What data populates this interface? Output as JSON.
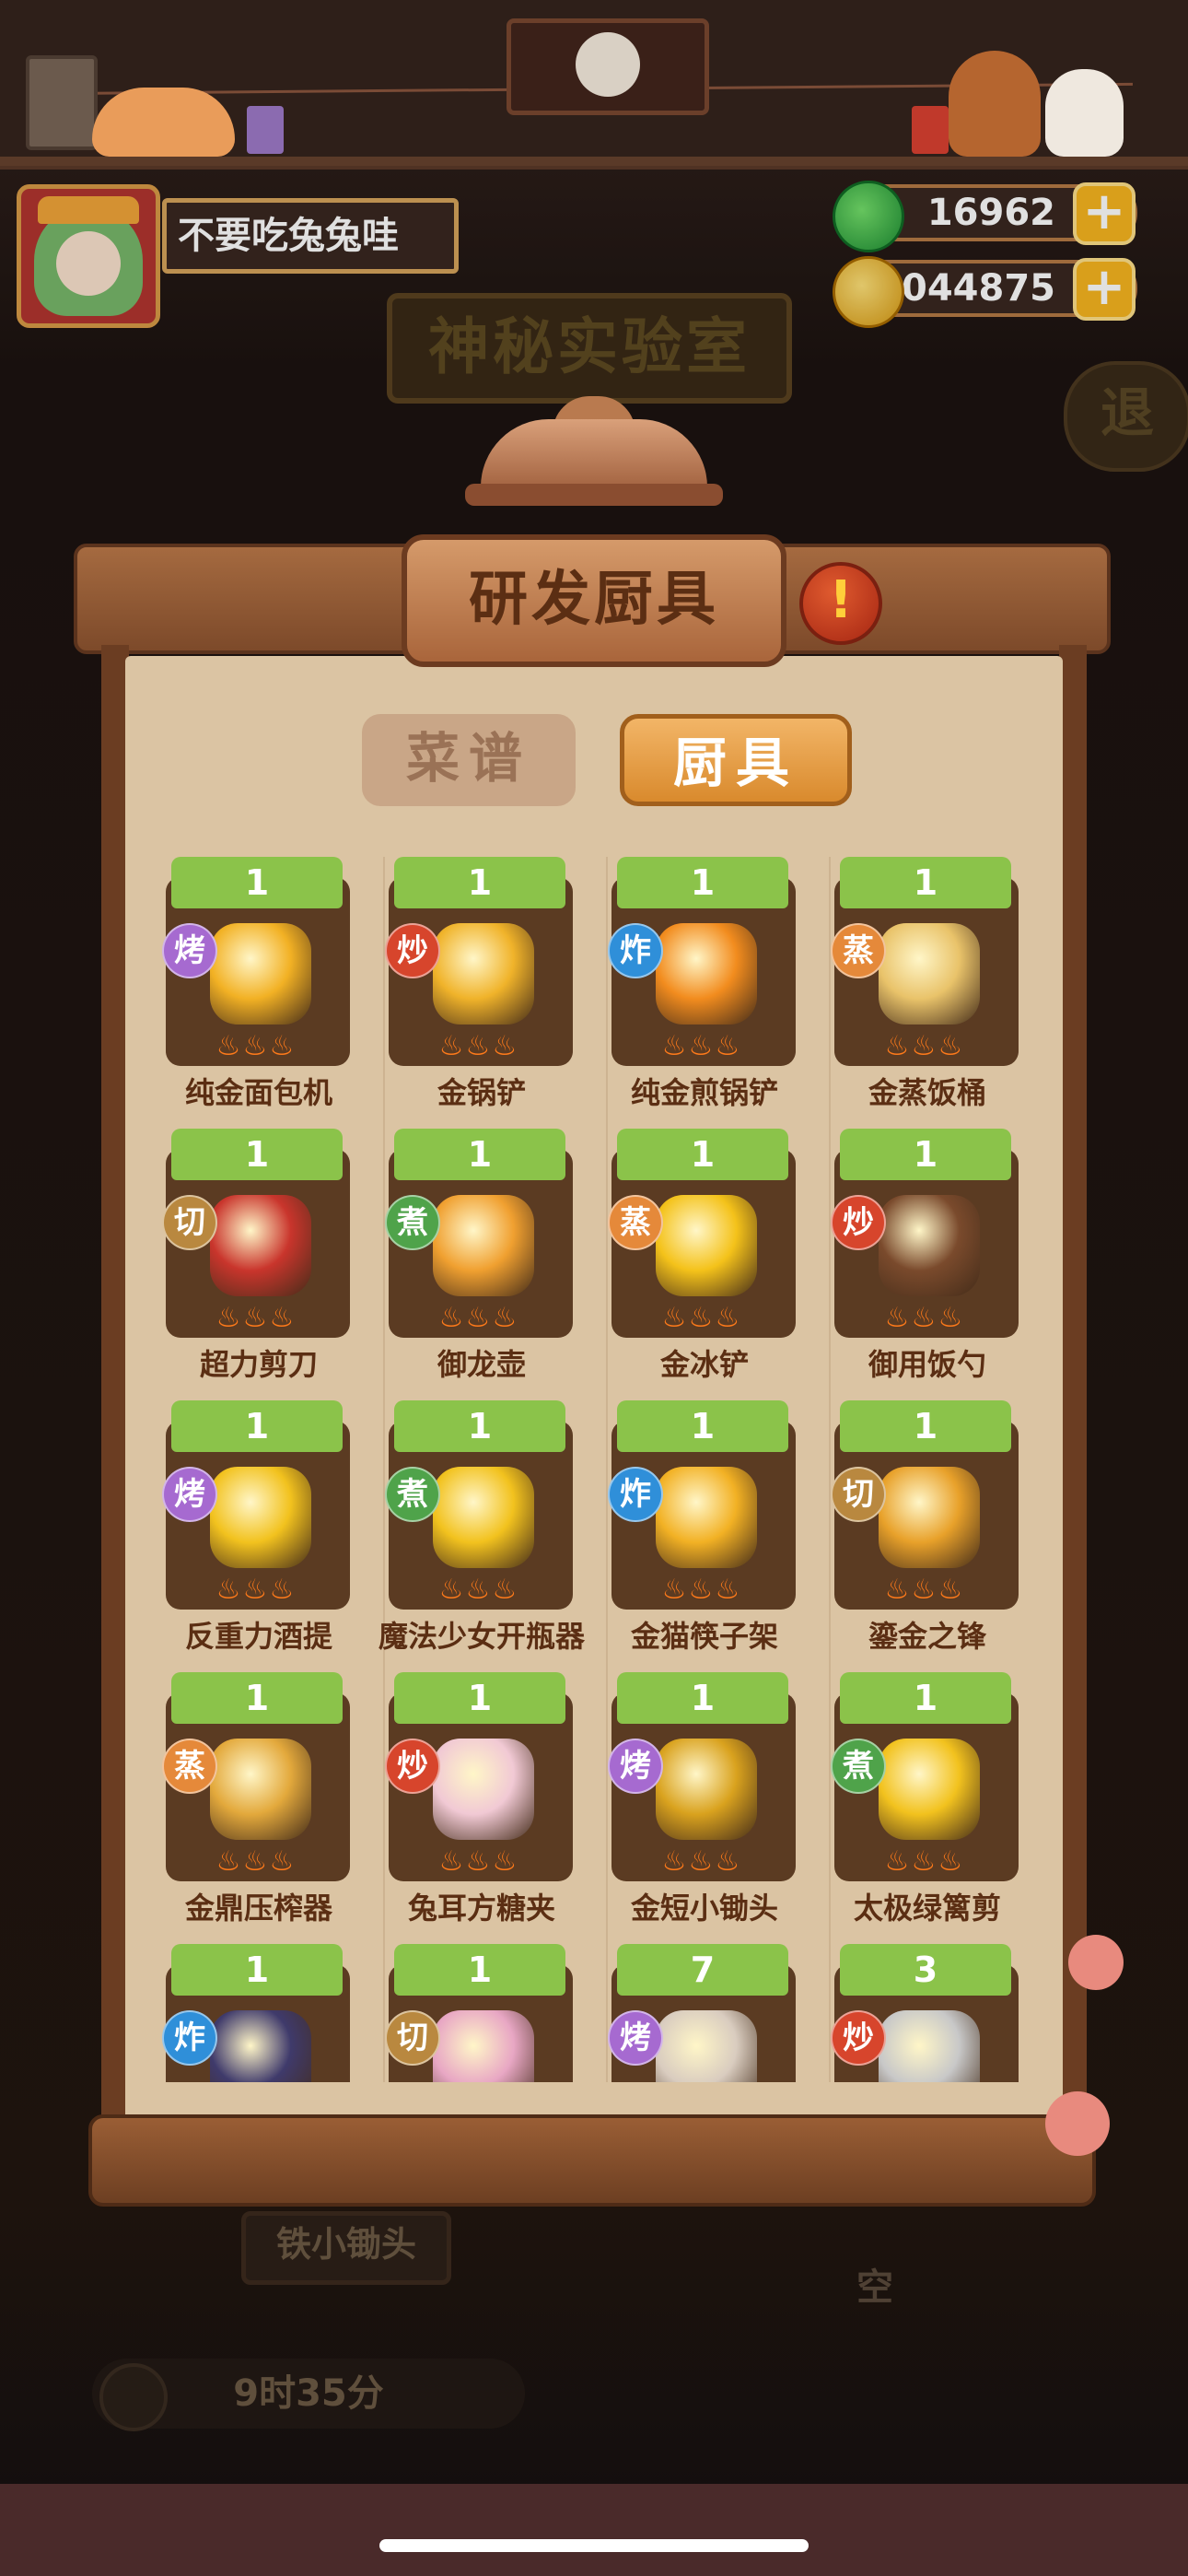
{
  "player": {
    "name": "不要吃兔兔哇"
  },
  "currency": {
    "jade": "16962",
    "coins": "80044875",
    "plus": "+"
  },
  "background": {
    "lab_title": "神秘实验室",
    "exit_label": "退",
    "station_label": "铁小锄头",
    "slot_status": "空",
    "timer": "9时35分"
  },
  "panel": {
    "title": "研发厨具",
    "alert_symbol": "!",
    "tabs": [
      {
        "label": "菜谱",
        "active": false
      },
      {
        "label": "厨具",
        "active": true
      }
    ]
  },
  "method_colors": {
    "烤": "#a66ad0",
    "炒": "#d7452c",
    "炸": "#2f8fd9",
    "蒸": "#e5893a",
    "切": "#b9883f",
    "煮": "#4fa34a"
  },
  "items": [
    {
      "name": "纯金面包机",
      "count": "1",
      "method": "烤",
      "stars": 3,
      "icon": "golden-toaster-icon",
      "color": "#f2b124"
    },
    {
      "name": "金锅铲",
      "count": "1",
      "method": "炒",
      "stars": 3,
      "icon": "golden-spatula-icon",
      "color": "#f0b32a"
    },
    {
      "name": "纯金煎锅铲",
      "count": "1",
      "method": "炸",
      "stars": 3,
      "icon": "golden-fry-spatula-icon",
      "color": "#f28c1e"
    },
    {
      "name": "金蒸饭桶",
      "count": "1",
      "method": "蒸",
      "stars": 3,
      "icon": "golden-rice-steamer-icon",
      "color": "#e9c36a"
    },
    {
      "name": "超力剪刀",
      "count": "1",
      "method": "切",
      "stars": 3,
      "icon": "power-scissors-icon",
      "color": "#c9352c"
    },
    {
      "name": "御龙壶",
      "count": "1",
      "method": "煮",
      "stars": 3,
      "icon": "dragon-teapot-icon",
      "color": "#f0a030"
    },
    {
      "name": "金冰铲",
      "count": "1",
      "method": "蒸",
      "stars": 3,
      "icon": "golden-ice-scoop-icon",
      "color": "#f4c21a"
    },
    {
      "name": "御用饭勺",
      "count": "1",
      "method": "炒",
      "stars": 3,
      "icon": "royal-rice-ladle-icon",
      "color": "#7a4a2c"
    },
    {
      "name": "反重力酒提",
      "count": "1",
      "method": "烤",
      "stars": 3,
      "icon": "antigravity-wine-dipper-icon",
      "color": "#f2c21e"
    },
    {
      "name": "魔法少女开瓶器",
      "count": "1",
      "method": "煮",
      "stars": 3,
      "icon": "magic-bottle-opener-icon",
      "color": "#f2c21e"
    },
    {
      "name": "金猫筷子架",
      "count": "1",
      "method": "炸",
      "stars": 3,
      "icon": "golden-cat-chopstick-rest-icon",
      "color": "#f2b124"
    },
    {
      "name": "鎏金之锋",
      "count": "1",
      "method": "切",
      "stars": 3,
      "icon": "gilded-blade-icon",
      "color": "#e8a12a"
    },
    {
      "name": "金鼎压榨器",
      "count": "1",
      "method": "蒸",
      "stars": 3,
      "icon": "golden-press-icon",
      "color": "#e3a93c"
    },
    {
      "name": "兔耳方糖夹",
      "count": "1",
      "method": "炒",
      "stars": 3,
      "icon": "bunny-sugar-tongs-icon",
      "color": "#f1c9d4"
    },
    {
      "name": "金短小锄头",
      "count": "1",
      "method": "烤",
      "stars": 3,
      "icon": "golden-short-hoe-icon",
      "color": "#d9a21e"
    },
    {
      "name": "太极绿篱剪",
      "count": "1",
      "method": "煮",
      "stars": 3,
      "icon": "taiji-hedge-shears-icon",
      "color": "#f2c21e"
    },
    {
      "name": "",
      "count": "1",
      "method": "炸",
      "stars": 0,
      "icon": "bottle-item-icon",
      "color": "#3f3a6b"
    },
    {
      "name": "",
      "count": "1",
      "method": "切",
      "stars": 0,
      "icon": "pink-item-icon",
      "color": "#e8a7c4"
    },
    {
      "name": "",
      "count": "7",
      "method": "烤",
      "stars": 0,
      "icon": "toaster-item-icon",
      "color": "#d9ccbf"
    },
    {
      "name": "",
      "count": "3",
      "method": "炒",
      "stars": 0,
      "icon": "trowel-item-icon",
      "color": "#c8c8c8"
    }
  ]
}
